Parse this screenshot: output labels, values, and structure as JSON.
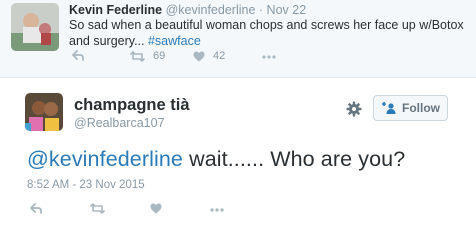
{
  "parent_tweet": {
    "name": "Kevin Federline",
    "handle": "@kevinfederline",
    "separator": "·",
    "date": "Nov 22",
    "text_before": "So sad when a beautiful woman chops and screws her face up w/Botox and surgery... ",
    "hashtag": "#sawface",
    "retweet_count": "69",
    "like_count": "42"
  },
  "main_tweet": {
    "name": "champagne tià",
    "handle": "@Realbarca107",
    "follow_label": "Follow",
    "mention": "@kevinfederline",
    "text": " wait...... Who are you?",
    "timestamp": "8:52 AM - 23 Nov 2015"
  },
  "icons": [
    "reply-icon",
    "retweet-icon",
    "heart-icon",
    "more-icon",
    "gear-icon",
    "follow-person-icon"
  ],
  "colors": {
    "link": "#2b7bb9",
    "muted": "#8899a6",
    "icon": "#aab8c2",
    "parent_bg": "#f5f8fa"
  }
}
